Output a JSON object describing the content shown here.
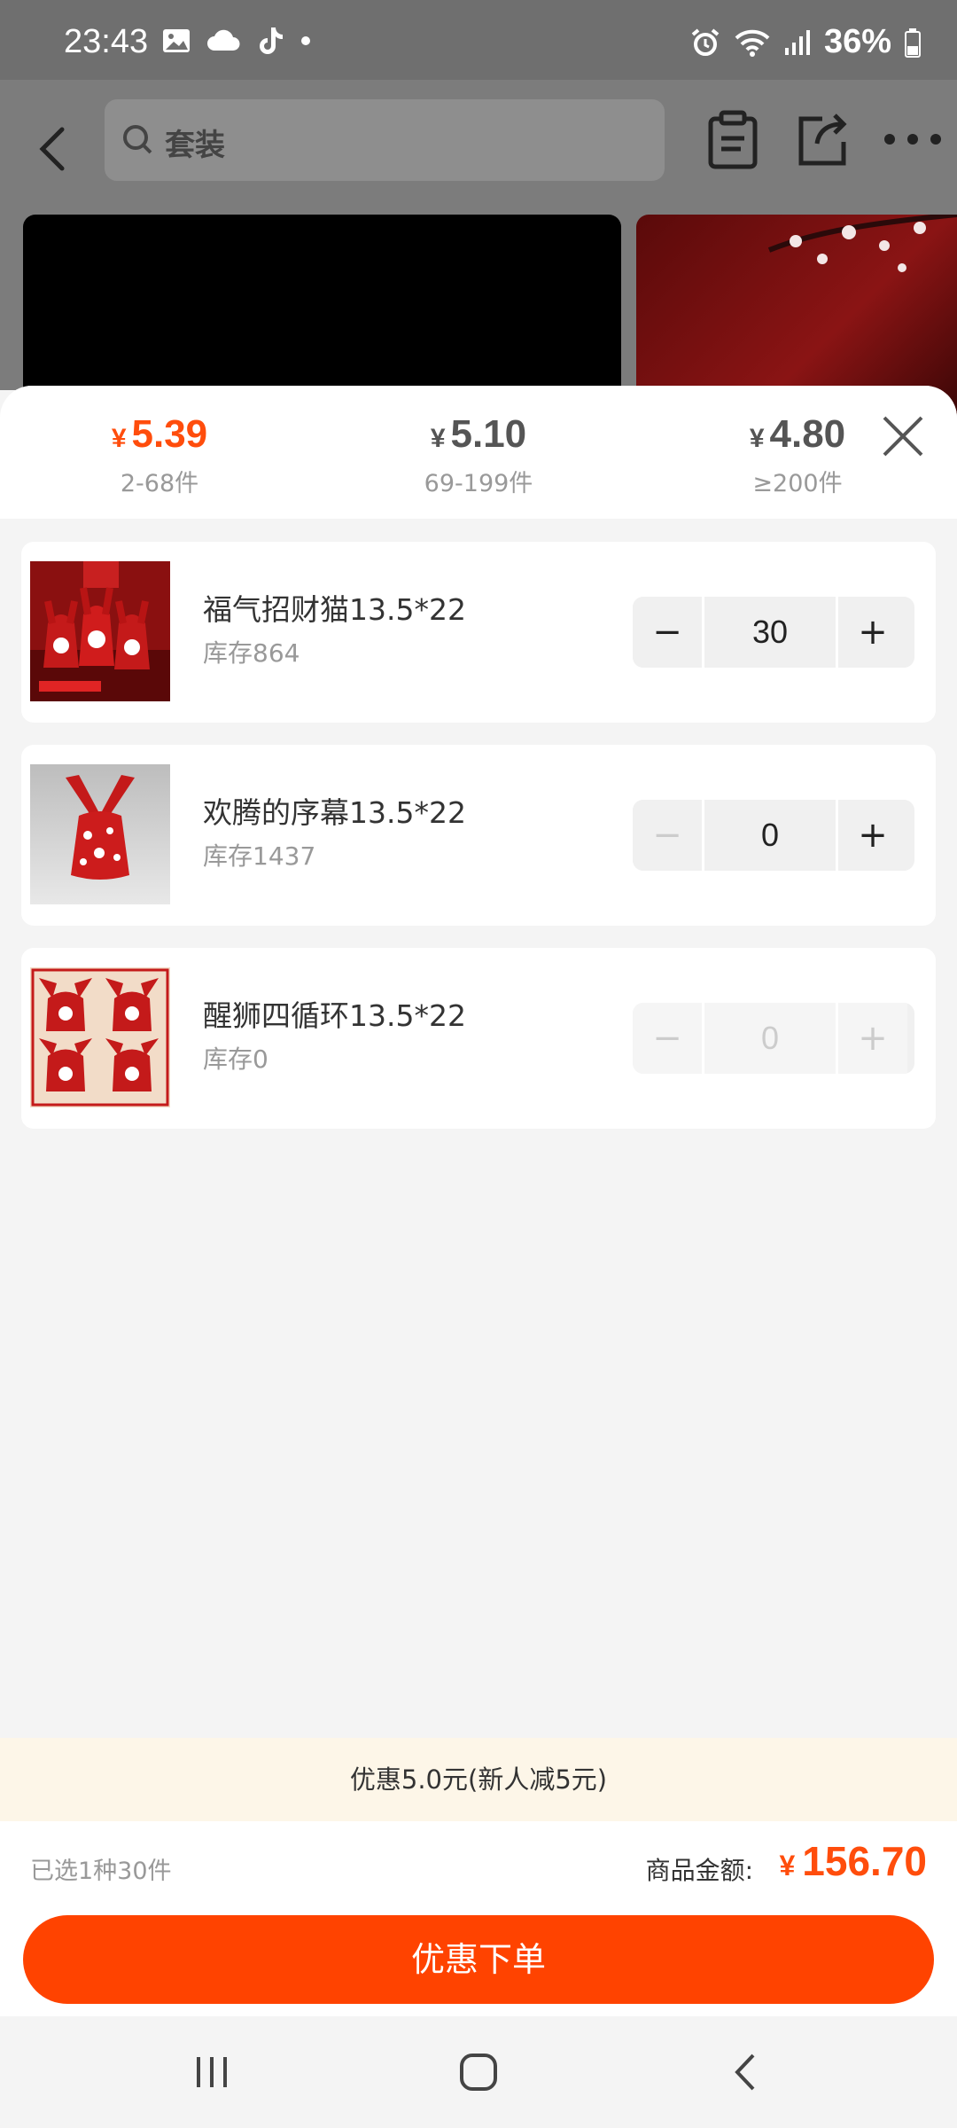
{
  "status_bar": {
    "time": "23:43",
    "battery": "36%"
  },
  "header": {
    "search_placeholder": "套装"
  },
  "price_tiers": [
    {
      "price": "5.39",
      "range": "2-68件",
      "active": true
    },
    {
      "price": "5.10",
      "range": "69-199件",
      "active": false
    },
    {
      "price": "4.80",
      "range": "≥200件",
      "active": false
    }
  ],
  "currency_symbol": "¥",
  "items": [
    {
      "name": "福气招财猫13.5*22",
      "stock": "库存864",
      "quantity": "30"
    },
    {
      "name": "欢腾的序幕13.5*22",
      "stock": "库存1437",
      "quantity": "0"
    },
    {
      "name": "醒狮四循环13.5*22",
      "stock": "库存0",
      "quantity": "0"
    }
  ],
  "stepper": {
    "minus": "−",
    "plus": "+"
  },
  "discount_text": "优惠5.0元(新人减5元)",
  "summary": {
    "selected": "已选1种30件",
    "amount_label": "商品金额:",
    "amount": "156.70"
  },
  "order_button": "优惠下单",
  "colors": {
    "accent": "#ff4d0c",
    "button": "#ff4300",
    "discount_bg": "#fdf6e8"
  }
}
